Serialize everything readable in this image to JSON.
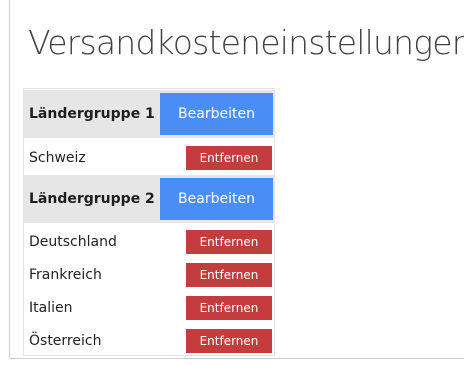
{
  "page": {
    "title": "Versandkosteneinstellungen"
  },
  "groups": [
    {
      "title": "Ländergruppe 1",
      "edit_label": "Bearbeiten",
      "countries": [
        {
          "name": "Schweiz",
          "remove_label": "Entfernen"
        }
      ]
    },
    {
      "title": "Ländergruppe 2",
      "edit_label": "Bearbeiten",
      "countries": [
        {
          "name": "Deutschland",
          "remove_label": "Entfernen"
        },
        {
          "name": "Frankreich",
          "remove_label": "Entfernen"
        },
        {
          "name": "Italien",
          "remove_label": "Entfernen"
        },
        {
          "name": "Österreich",
          "remove_label": "Entfernen"
        }
      ]
    }
  ],
  "colors": {
    "edit_button": "#4a8df5",
    "remove_button": "#c43d3d",
    "group_header_bg": "#e6e6e6",
    "title_text": "#424242"
  }
}
